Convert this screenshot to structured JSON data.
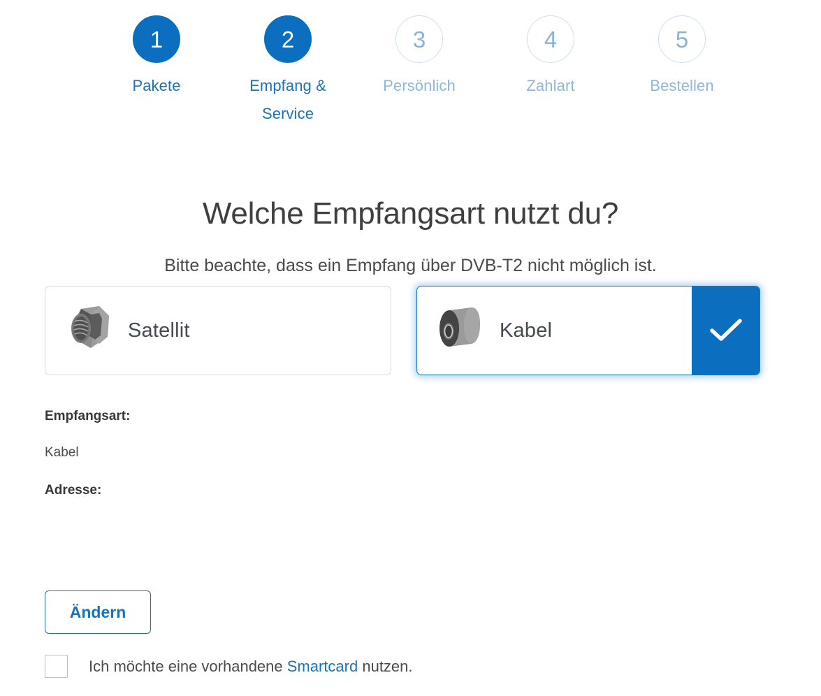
{
  "stepper": {
    "steps": [
      {
        "number": "1",
        "label": "Pakete",
        "state": "active"
      },
      {
        "number": "2",
        "label": "Empfang & Service",
        "state": "active"
      },
      {
        "number": "3",
        "label": "Persönlich",
        "state": "inactive"
      },
      {
        "number": "4",
        "label": "Zahlart",
        "state": "inactive"
      },
      {
        "number": "5",
        "label": "Bestellen",
        "state": "inactive"
      }
    ],
    "active_color": "#0B6EBF",
    "active_label_color": "#1a72b8",
    "inactive_label_color": "#8cb8dc",
    "inactive_border_color": "#cfe0ef"
  },
  "main": {
    "headline": "Welche Empfangsart nutzt du?",
    "subheadline": "Bitte beachte, dass ein Empfang über DVB-T2 nicht möglich ist."
  },
  "options": [
    {
      "id": "satellit",
      "label": "Satellit",
      "icon": "f-connector-nut-icon",
      "selected": false
    },
    {
      "id": "kabel",
      "label": "Kabel",
      "icon": "coaxial-connector-icon",
      "selected": true,
      "check_icon": "check-icon",
      "check_panel_color": "#0B6EBF"
    }
  ],
  "details": {
    "reception_label": "Empfangsart:",
    "reception_value": "Kabel",
    "address_label": "Adresse:",
    "address_value": ""
  },
  "actions": {
    "change_button": "Ändern"
  },
  "smartcard": {
    "text_before": "Ich möchte eine vorhandene ",
    "link": "Smartcard",
    "text_after": " nutzen.",
    "checked": false,
    "link_color": "#1a72b8"
  }
}
